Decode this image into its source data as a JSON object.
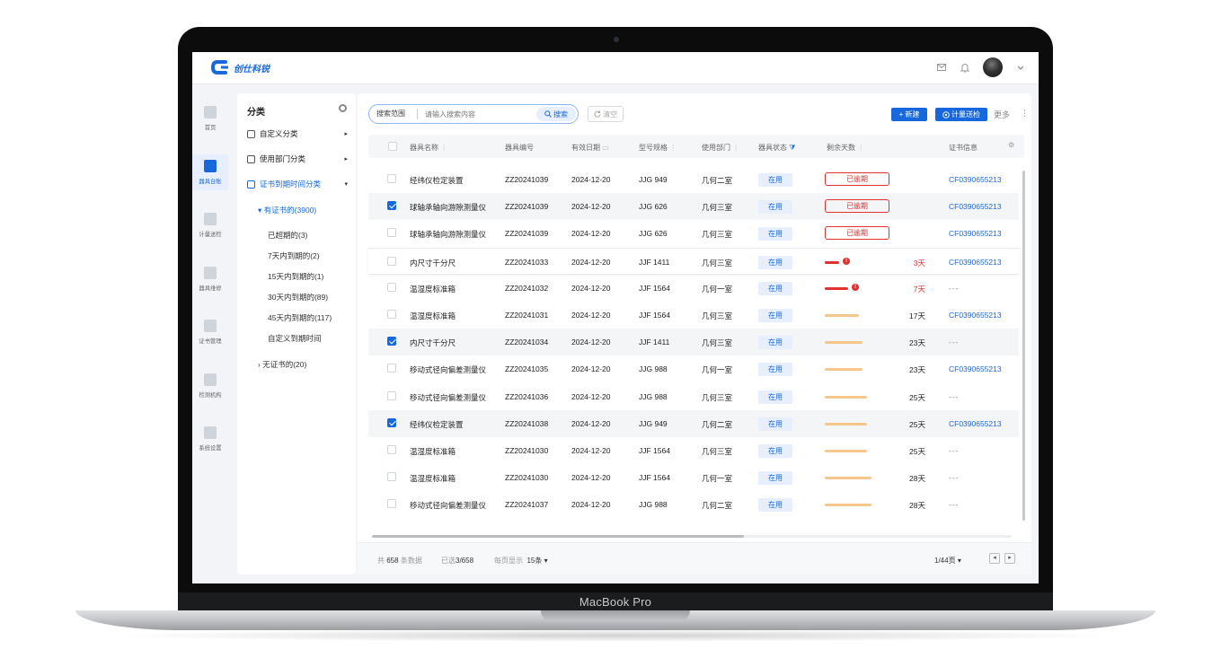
{
  "device": {
    "label": "MacBook Pro"
  },
  "app": {
    "brand": "创仕科锐"
  },
  "header": {
    "icons": [
      "mail-icon",
      "bell-icon",
      "avatar",
      "chevron-down-icon"
    ]
  },
  "nav": [
    {
      "label": "首页",
      "icon": "home-icon",
      "active": false
    },
    {
      "label": "器具台账",
      "icon": "cube-icon",
      "active": true
    },
    {
      "label": "计量送检",
      "icon": "monitor-icon",
      "active": false
    },
    {
      "label": "器具维修",
      "icon": "wrench-icon",
      "active": false
    },
    {
      "label": "证书管理",
      "icon": "certificate-icon",
      "active": false
    },
    {
      "label": "检测机构",
      "icon": "building-icon",
      "active": false
    },
    {
      "label": "系统设置",
      "icon": "settings-icon",
      "active": false
    }
  ],
  "category": {
    "title": "分类",
    "items": [
      {
        "label": "自定义分类",
        "icon": "tools-icon",
        "arrow": "▸"
      },
      {
        "label": "使用部门分类",
        "icon": "layers-icon",
        "arrow": "▸"
      },
      {
        "label": "证书到期时间分类",
        "icon": "document-icon",
        "arrow": "▾"
      }
    ],
    "with_cert": "有证书的(3900)",
    "leaves": [
      "已超期的(3)",
      "7天内到期的(2)",
      "15天内到期的(1)",
      "30天内到期的(89)",
      "45天内到期的(117)",
      "自定义到期时间"
    ],
    "without_cert": "无证书的(20)"
  },
  "toolbar": {
    "scope": "搜索范围",
    "search_placeholder": "请输入搜索内容",
    "search_btn": "搜索",
    "clear_btn": "清空",
    "new_btn": "新建",
    "send_btn": "计量送检",
    "more": "更多",
    "more_dots": "⋮"
  },
  "table": {
    "columns": [
      "器具名称",
      "器具编号",
      "有效日期",
      "型号规格",
      "使用部门",
      "器具状态",
      "剩余天数",
      "证书信息"
    ],
    "rows": [
      {
        "checked": false,
        "name": "经纬仪检定装置",
        "code": "ZZ20241039",
        "date": "2024-12-20",
        "model": "JJG 949",
        "dept": "几何二室",
        "status": "在用",
        "kind": "overdue",
        "remain": "已逾期",
        "cert": "CF0390655213"
      },
      {
        "checked": true,
        "name": "球轴承轴向游隙测量仪",
        "code": "ZZ20241039",
        "date": "2024-12-20",
        "model": "JJG 626",
        "dept": "几何三室",
        "status": "在用",
        "kind": "overdue",
        "remain": "已逾期",
        "cert": "CF0390655213"
      },
      {
        "checked": false,
        "name": "球轴承轴向游隙测量仪",
        "code": "ZZ20241039",
        "date": "2024-12-20",
        "model": "JJG 626",
        "dept": "几何三室",
        "status": "在用",
        "kind": "overdue",
        "remain": "已逾期",
        "cert": "CF0390655213"
      },
      {
        "checked": false,
        "name": "内尺寸千分尺",
        "code": "ZZ20241033",
        "date": "2024-12-20",
        "model": "JJF 1411",
        "dept": "几何三室",
        "status": "在用",
        "kind": "urgent",
        "remain": "3天",
        "fill": 0.22,
        "cert": "CF0390655213"
      },
      {
        "checked": false,
        "name": "温湿度标准箱",
        "code": "ZZ20241032",
        "date": "2024-12-20",
        "model": "JJF 1564",
        "dept": "几何一室",
        "status": "在用",
        "kind": "urgent",
        "remain": "7天",
        "fill": 0.36,
        "cert": "---"
      },
      {
        "checked": false,
        "name": "温湿度标准箱",
        "code": "ZZ20241031",
        "date": "2024-12-20",
        "model": "JJF 1564",
        "dept": "几何三室",
        "status": "在用",
        "kind": "normal",
        "remain": "17天",
        "fill": 0.53,
        "cert": "CF0390655213"
      },
      {
        "checked": true,
        "name": "内尺寸千分尺",
        "code": "ZZ20241034",
        "date": "2024-12-20",
        "model": "JJF 1411",
        "dept": "几何三室",
        "status": "在用",
        "kind": "normal",
        "remain": "23天",
        "fill": 0.59,
        "cert": "---"
      },
      {
        "checked": false,
        "name": "移动式径向偏差测量仪",
        "code": "ZZ20241035",
        "date": "2024-12-20",
        "model": "JJG 988",
        "dept": "几何一室",
        "status": "在用",
        "kind": "normal",
        "remain": "23天",
        "fill": 0.59,
        "cert": "CF0390655213"
      },
      {
        "checked": false,
        "name": "移动式径向偏差测量仪",
        "code": "ZZ20241036",
        "date": "2024-12-20",
        "model": "JJG 988",
        "dept": "几何三室",
        "status": "在用",
        "kind": "normal",
        "remain": "25天",
        "fill": 0.65,
        "cert": "---"
      },
      {
        "checked": true,
        "name": "经纬仪检定装置",
        "code": "ZZ20241038",
        "date": "2024-12-20",
        "model": "JJG 949",
        "dept": "几何二室",
        "status": "在用",
        "kind": "normal",
        "remain": "25天",
        "fill": 0.65,
        "cert": "CF0390655213"
      },
      {
        "checked": false,
        "name": "温湿度标准箱",
        "code": "ZZ20241030",
        "date": "2024-12-20",
        "model": "JJF 1564",
        "dept": "几何三室",
        "status": "在用",
        "kind": "normal",
        "remain": "25天",
        "fill": 0.65,
        "cert": "---"
      },
      {
        "checked": false,
        "name": "温湿度标准箱",
        "code": "ZZ20241030",
        "date": "2024-12-20",
        "model": "JJF 1564",
        "dept": "几何一室",
        "status": "在用",
        "kind": "normal",
        "remain": "28天",
        "fill": 0.72,
        "cert": "---"
      },
      {
        "checked": false,
        "name": "移动式径向偏差测量仪",
        "code": "ZZ20241037",
        "date": "2024-12-20",
        "model": "JJG 988",
        "dept": "几何二室",
        "status": "在用",
        "kind": "normal",
        "remain": "28天",
        "fill": 0.72,
        "cert": "---"
      }
    ]
  },
  "footer": {
    "total_prefix": "共",
    "total": "658",
    "total_suffix": "条数据",
    "selected_prefix": "已选",
    "selected": "3/658",
    "page_size_label": "每页显示",
    "page_size": "15条",
    "page": "1/44页"
  },
  "colors": {
    "accent": "#1668dc",
    "danger": "#e03131",
    "progress": "#f6c78d"
  }
}
